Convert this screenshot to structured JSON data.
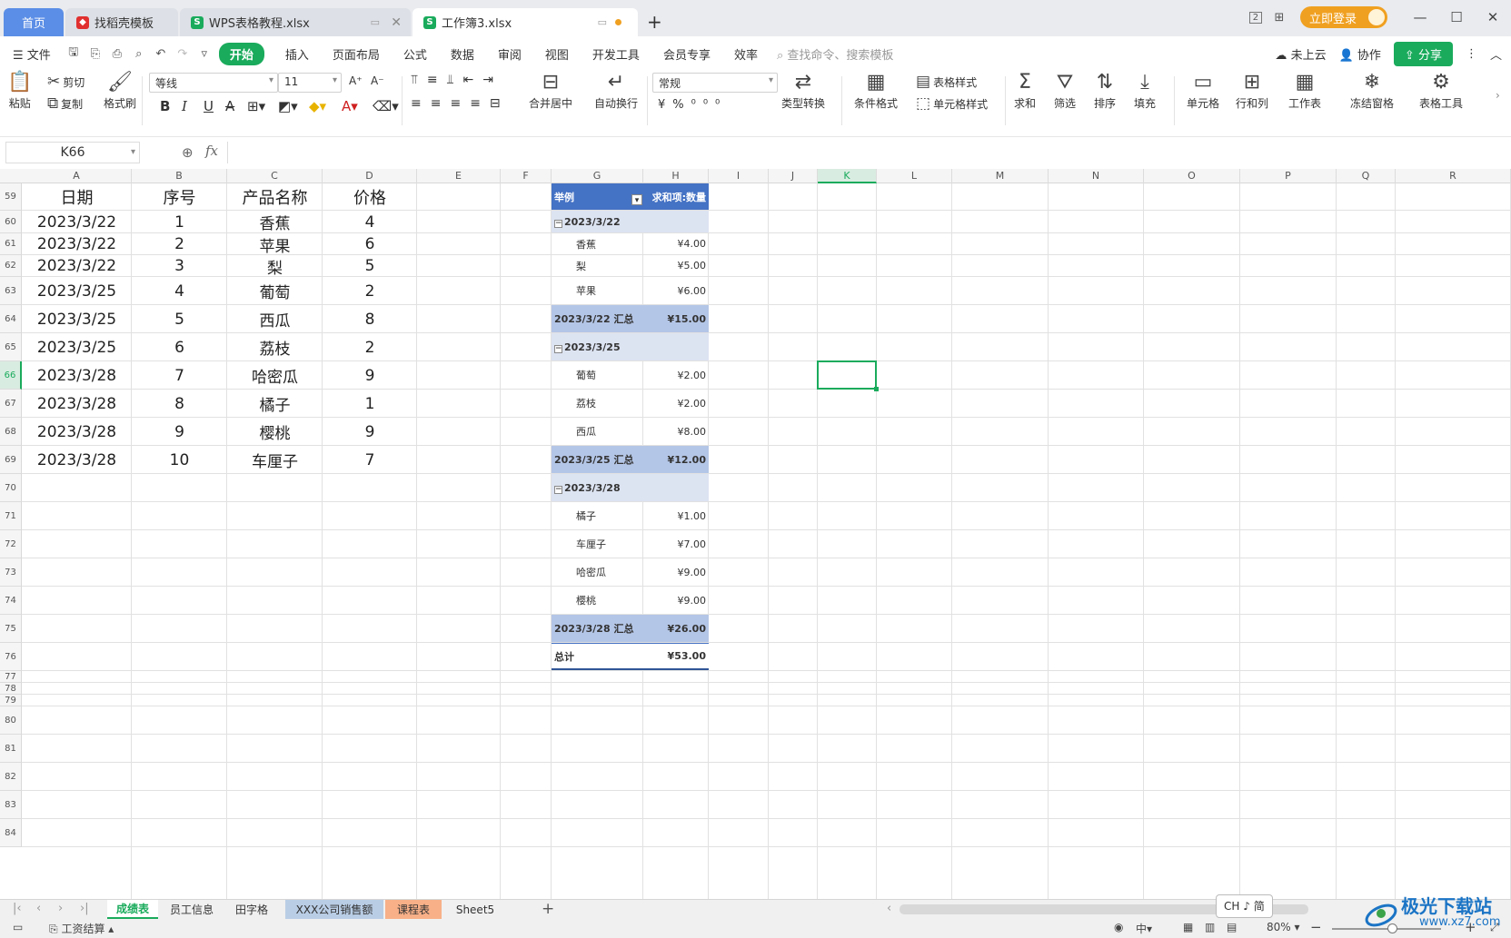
{
  "tabs": {
    "home": "首页",
    "templates": "找稻壳模板",
    "file1": "WPS表格教程.xlsx",
    "file2": "工作簿3.xlsx"
  },
  "titlebar": {
    "login": "立即登录",
    "win_badge": "2"
  },
  "menu": {
    "file": "文件",
    "items": [
      "开始",
      "插入",
      "页面布局",
      "公式",
      "数据",
      "审阅",
      "视图",
      "开发工具",
      "会员专享",
      "效率"
    ],
    "search_placeholder": "查找命令、搜索模板",
    "cloud": "未上云",
    "collab": "协作",
    "share": "分享"
  },
  "ribbon": {
    "paste": "粘贴",
    "cut": "剪切",
    "copy": "复制",
    "format_painter": "格式刷",
    "font_name": "等线",
    "font_size": "11",
    "number_format": "常规",
    "merge_center": "合并居中",
    "wrap": "自动换行",
    "type_convert": "类型转换",
    "cond_format": "条件格式",
    "table_style": "表格样式",
    "cell_style": "单元格样式",
    "sum": "求和",
    "filter": "筛选",
    "sort": "排序",
    "fill": "填充",
    "cells": "单元格",
    "row_col": "行和列",
    "worksheet": "工作表",
    "freeze": "冻结窗格",
    "table_tools": "表格工具"
  },
  "formula_bar": {
    "cell_ref": "K66",
    "formula": ""
  },
  "columns": [
    "A",
    "B",
    "C",
    "D",
    "E",
    "F",
    "G",
    "H",
    "I",
    "J",
    "K",
    "L",
    "M",
    "N",
    "O",
    "P",
    "Q",
    "R"
  ],
  "row_numbers": [
    "59",
    "60",
    "61",
    "62",
    "63",
    "64",
    "65",
    "66",
    "67",
    "68",
    "69",
    "70",
    "71",
    "72",
    "73",
    "74",
    "75",
    "76",
    "77",
    "78",
    "79",
    "80",
    "81",
    "82",
    "83",
    "84"
  ],
  "table": {
    "headers": [
      "日期",
      "序号",
      "产品名称",
      "价格"
    ],
    "rows": [
      [
        "2023/3/22",
        "1",
        "香蕉",
        "4"
      ],
      [
        "2023/3/22",
        "2",
        "苹果",
        "6"
      ],
      [
        "2023/3/22",
        "3",
        "梨",
        "5"
      ],
      [
        "2023/3/25",
        "4",
        "葡萄",
        "2"
      ],
      [
        "2023/3/25",
        "5",
        "西瓜",
        "8"
      ],
      [
        "2023/3/25",
        "6",
        "荔枝",
        "2"
      ],
      [
        "2023/3/28",
        "7",
        "哈密瓜",
        "9"
      ],
      [
        "2023/3/28",
        "8",
        "橘子",
        "1"
      ],
      [
        "2023/3/28",
        "9",
        "樱桃",
        "9"
      ],
      [
        "2023/3/28",
        "10",
        "车厘子",
        "7"
      ]
    ]
  },
  "pivot": {
    "header_left": "举例",
    "header_right": "求和项:数量",
    "groups": [
      {
        "label": "2023/3/22",
        "items": [
          [
            "香蕉",
            "¥4.00"
          ],
          [
            "梨",
            "¥5.00"
          ],
          [
            "苹果",
            "¥6.00"
          ]
        ],
        "subtotal_label": "2023/3/22 汇总",
        "subtotal": "¥15.00"
      },
      {
        "label": "2023/3/25",
        "items": [
          [
            "葡萄",
            "¥2.00"
          ],
          [
            "荔枝",
            "¥2.00"
          ],
          [
            "西瓜",
            "¥8.00"
          ]
        ],
        "subtotal_label": "2023/3/25 汇总",
        "subtotal": "¥12.00"
      },
      {
        "label": "2023/3/28",
        "items": [
          [
            "橘子",
            "¥1.00"
          ],
          [
            "车厘子",
            "¥7.00"
          ],
          [
            "哈密瓜",
            "¥9.00"
          ],
          [
            "樱桃",
            "¥9.00"
          ]
        ],
        "subtotal_label": "2023/3/28 汇总",
        "subtotal": "¥26.00"
      }
    ],
    "total_label": "总计",
    "total": "¥53.00"
  },
  "sheets": {
    "tabs": [
      "成绩表",
      "员工信息",
      "田字格",
      "XXX公司销售额",
      "课程表",
      "Sheet5"
    ],
    "active": "成绩表",
    "colors": {
      "XXX公司销售额": "#b9cde5",
      "课程表": "#f8b088"
    }
  },
  "statusbar": {
    "macro": "工资结算",
    "zoom": "80%",
    "zoom_level": 0.55,
    "ime": "CH ♪ 简",
    "input_mode": "中"
  },
  "watermark": {
    "text": "极光下载站",
    "url": "www.xz7.com"
  },
  "colors": {
    "accent": "#1aab5c",
    "pivot_header": "#4472c4",
    "pivot_group": "#dce3f1",
    "pivot_subtotal": "#b4c6e7"
  }
}
